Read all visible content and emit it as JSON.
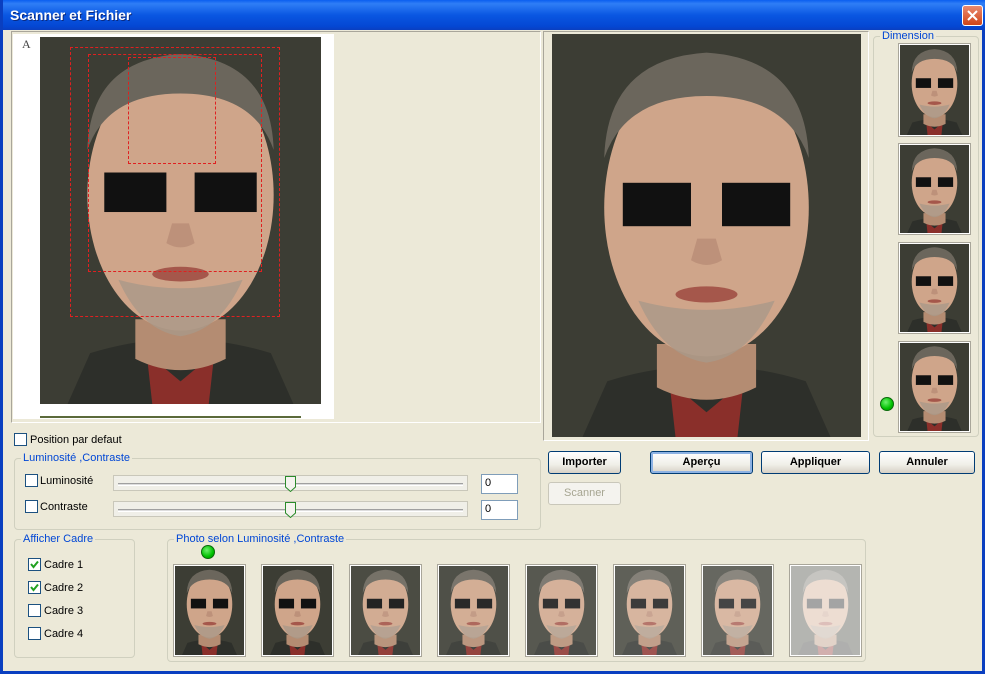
{
  "window": {
    "title": "Scanner et Fichier"
  },
  "options": {
    "position_default_label": "Position par defaut"
  },
  "luminosite_group": {
    "title": "Luminosité ,Contraste",
    "luminosite": {
      "label": "Luminosité",
      "value": "0",
      "checked": false,
      "level": 0.5
    },
    "contraste": {
      "label": "Contraste",
      "value": "0",
      "checked": false,
      "level": 0.5
    }
  },
  "buttons": {
    "importer": "Importer",
    "apercu": "Aperçu",
    "appliquer": "Appliquer",
    "annuler": "Annuler",
    "scanner": "Scanner"
  },
  "cadre_group": {
    "title": "Afficher Cadre",
    "items": [
      {
        "label": "Cadre 1",
        "checked": true
      },
      {
        "label": "Cadre 2",
        "checked": true
      },
      {
        "label": "Cadre 3",
        "checked": false
      },
      {
        "label": "Cadre 4",
        "checked": false
      }
    ]
  },
  "photo_group": {
    "title": "Photo selon Luminosité ,Contraste"
  },
  "dimension_group": {
    "title": "Dimension"
  },
  "source_mark": "A",
  "colors": {
    "accent": "#0046d5",
    "status": "#00c000",
    "title_bar": "#0a57e2"
  }
}
